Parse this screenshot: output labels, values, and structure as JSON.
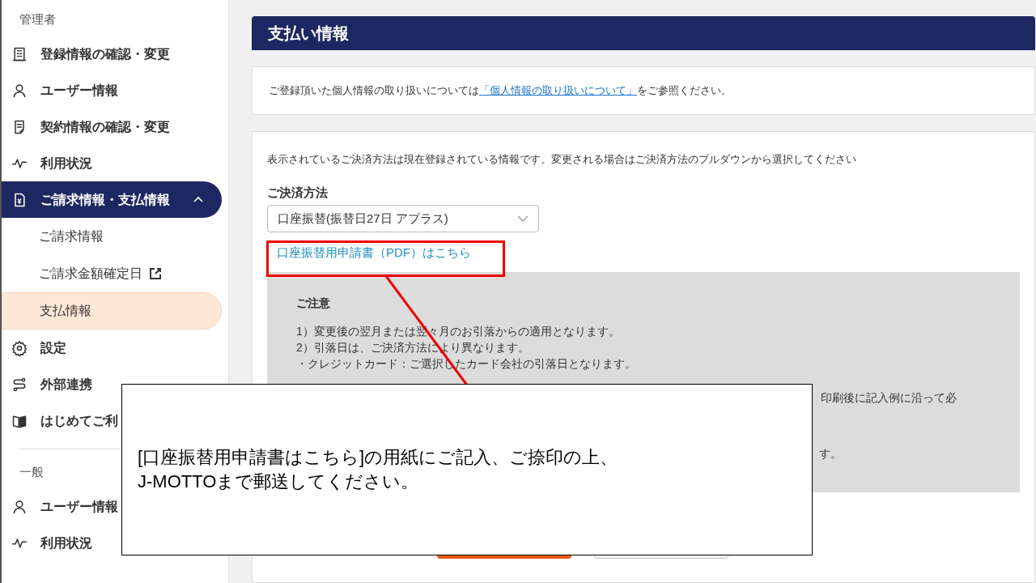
{
  "sidebar": {
    "sections": [
      {
        "heading": "管理者",
        "items": [
          {
            "label": "登録情報の確認・変更",
            "selected": false
          },
          {
            "label": "ユーザー情報",
            "selected": false
          },
          {
            "label": "契約情報の確認・変更",
            "selected": false
          },
          {
            "label": "利用状況",
            "selected": false
          },
          {
            "label": "ご請求情報・支払情報",
            "selected": true,
            "expanded": true,
            "children": [
              {
                "label": "ご請求情報",
                "external": false,
                "selected": false
              },
              {
                "label": "ご請求金額確定日",
                "external": true,
                "selected": false
              },
              {
                "label": "支払情報",
                "external": false,
                "selected": true
              }
            ]
          },
          {
            "label": "設定",
            "selected": false
          },
          {
            "label": "外部連携",
            "selected": false
          },
          {
            "label": "はじめてご利",
            "selected": false
          }
        ]
      },
      {
        "heading": "一般",
        "items": [
          {
            "label": "ユーザー情報",
            "selected": false
          },
          {
            "label": "利用状況",
            "selected": false
          }
        ]
      }
    ]
  },
  "page_title": "支払い情報",
  "privacy_notice": {
    "before": "ご登録頂いた個人情報の取り扱いについては",
    "link": "「個人情報の取り扱いについて」",
    "after": "をご参照ください。"
  },
  "payment": {
    "description": "表示されているご決済方法は現在登録されている情報です。変更される場合はご決済方法のプルダウンから選択してください",
    "field_label": "ご決済方法",
    "select_value": "口座振替(振替日27日 アプラス)",
    "pdf_link": "口座振替用申請書（PDF）はこちら",
    "notice": {
      "title": "ご注意",
      "lines": [
        "1）変更後の翌月または翌々月のお引落からの適用となります。",
        "2）引落日は、ご決済方法により異なります。",
        "・クレジットカード：ご選択したカード会社の引落日となります。"
      ],
      "fragments": [
        "印刷後に記入例に沿って必",
        "す。"
      ]
    },
    "buttons": [
      {
        "kind": "primary"
      },
      {
        "kind": "secondary"
      }
    ]
  },
  "callout": {
    "lines": [
      "[口座振替用申請書はこちら]の用紙にご記入、ご捺印の上、",
      "J-MOTTOまで郵送してください。"
    ]
  }
}
